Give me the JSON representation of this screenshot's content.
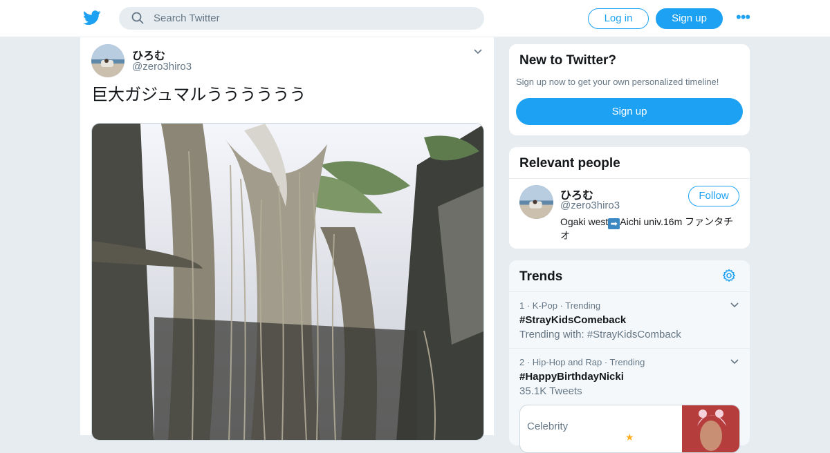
{
  "header": {
    "search_placeholder": "Search Twitter",
    "login_label": "Log in",
    "signup_label": "Sign up",
    "more_label": "•••"
  },
  "tweet": {
    "name": "ひろむ",
    "handle": "@zero3hiro3",
    "text": "巨大ガジュマルうううううう"
  },
  "new_to_twitter": {
    "title": "New to Twitter?",
    "subtitle": "Sign up now to get your own personalized timeline!",
    "button_label": "Sign up"
  },
  "relevant_people": {
    "title": "Relevant people",
    "name": "ひろむ",
    "handle": "@zero3hiro3",
    "follow_label": "Follow",
    "bio_before": "Ogaki west",
    "bio_after": "Aichi univ.16m ファンタチオ"
  },
  "trends": {
    "title": "Trends",
    "items": [
      {
        "rank": "1",
        "category": "K-Pop · Trending",
        "name": "#StrayKidsComeback",
        "sub": "Trending with: #StrayKidsComback"
      },
      {
        "rank": "2",
        "category": "Hip-Hop and Rap · Trending",
        "name": "#HappyBirthdayNicki",
        "sub": "35.1K Tweets"
      }
    ],
    "news_category": "Celebrity"
  },
  "colors": {
    "accent": "#1da1f2",
    "background": "#e6ecf0",
    "secondary_text": "#657786"
  }
}
